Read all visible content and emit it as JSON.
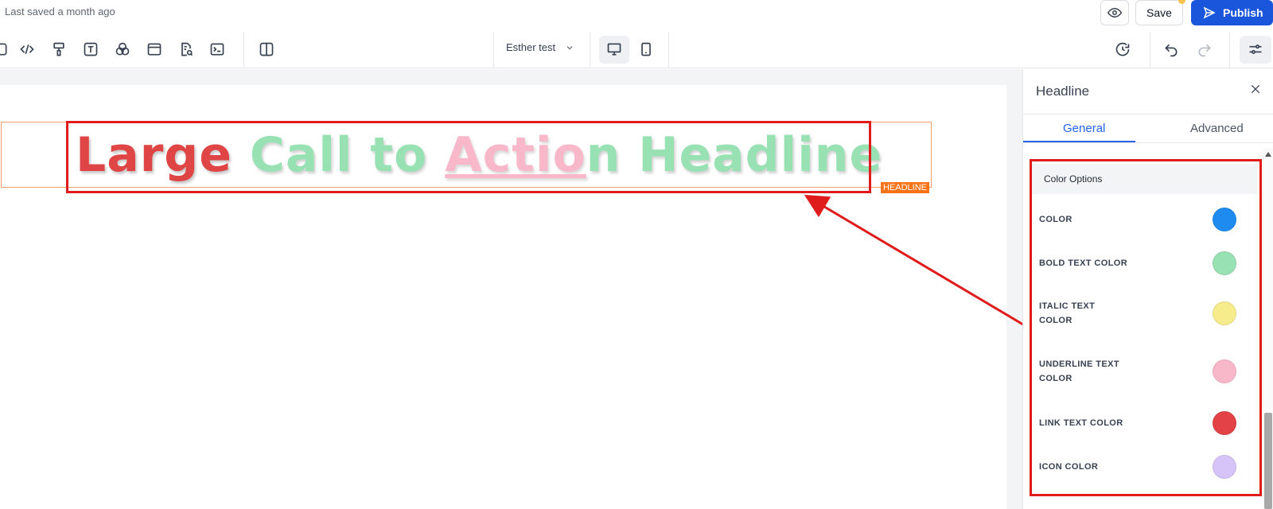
{
  "topbar": {
    "last_saved": "Last saved a month ago",
    "save_label": "Save",
    "publish_label": "Publish"
  },
  "toolbar": {
    "icons": [
      "square-icon",
      "code-icon",
      "paint-roller-icon",
      "text-icon",
      "color-circles-icon",
      "window-icon",
      "document-search-icon",
      "terminal-icon",
      "columns-icon"
    ],
    "user_select": "Esther test",
    "active_device": "desktop"
  },
  "canvas": {
    "headline_words": {
      "w1": "Large",
      "w2": "Call to",
      "w3": "Actio",
      "w4": "n Headline"
    },
    "element_tag": "HEADLINE"
  },
  "panel": {
    "title": "Headline",
    "tabs": [
      {
        "label": "General",
        "active": true
      },
      {
        "label": "Advanced",
        "active": false
      }
    ],
    "group_title": "Color Options",
    "options": [
      {
        "label": "COLOR",
        "color": "#1e8bf0"
      },
      {
        "label": "BOLD TEXT COLOR",
        "color": "#98e1b3"
      },
      {
        "label": "ITALIC TEXT COLOR",
        "color": "#f7ec8c"
      },
      {
        "label": "UNDERLINE TEXT COLOR",
        "color": "#f9b8c9"
      },
      {
        "label": "LINK TEXT COLOR",
        "color": "#e34346"
      },
      {
        "label": "ICON COLOR",
        "color": "#d6c4f9"
      }
    ]
  },
  "colors": {
    "accent": "#1a56db",
    "annotation": "#e01b1b",
    "tag": "#f97316"
  }
}
